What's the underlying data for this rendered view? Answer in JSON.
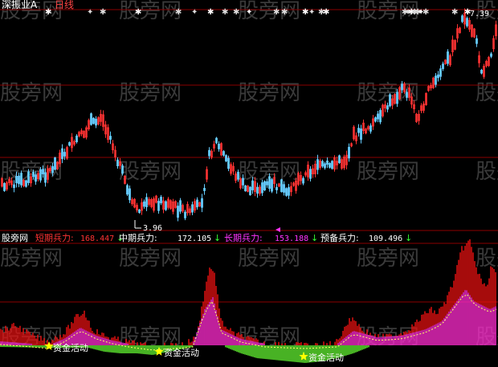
{
  "header": {
    "title": "深振业A",
    "period": "日线"
  },
  "price_panel": {
    "low_price_label": "3.96",
    "high_price_label": "7.39"
  },
  "indicator_bar": {
    "name": "股旁网",
    "items": [
      {
        "label": "短期兵力:",
        "value": "168.447",
        "arrow": "↓",
        "color": "#ff3333"
      },
      {
        "label": "中期兵力:",
        "value": "172.105",
        "arrow": "↓",
        "color": "#ffffff"
      },
      {
        "label": "长期兵力:",
        "value": "153.188",
        "arrow": "↓",
        "color": "#ff33ff"
      },
      {
        "label": "预备兵力:",
        "value": "109.496",
        "arrow": "↓",
        "color": "#ffffff"
      }
    ],
    "arrow_color": "#33ff33"
  },
  "signals": {
    "label": "资金活动"
  },
  "watermark": "股旁网",
  "colors": {
    "background": "#000000",
    "up_candle": "#ff3333",
    "down_candle": "#66ccff",
    "grid": "#8b0000",
    "red_bars": "#ee1111",
    "magenta_bars": "#ff33ff",
    "green_bars": "#66ff33",
    "mid_line": "#ffff66",
    "star": "#ffff00"
  }
}
